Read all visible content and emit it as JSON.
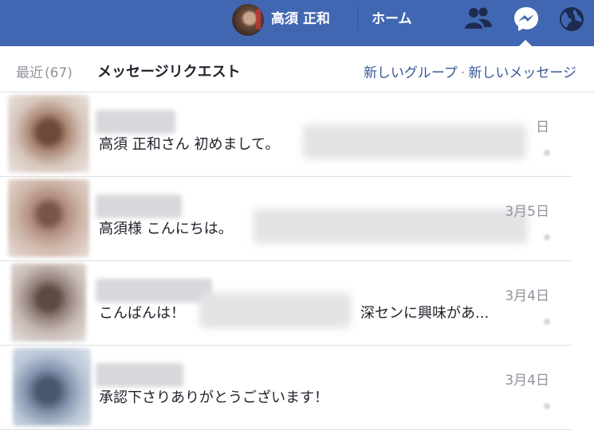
{
  "topbar": {
    "user_name": "高須 正和",
    "home_label": "ホーム",
    "icons": [
      "friends-icon",
      "messenger-icon",
      "globe-icon"
    ],
    "background": "#4267b2"
  },
  "header": {
    "recent_label": "最近",
    "recent_count": "(67)",
    "requests_label": "メッセージリクエスト",
    "new_group_label": "新しいグループ",
    "separator": "·",
    "new_message_label": "新しいメッセージ"
  },
  "messages": [
    {
      "text": "高須 正和さん 初めまして。",
      "date": "日"
    },
    {
      "text": "高須様 こんにちは。",
      "date": "3月5日"
    },
    {
      "text": "こんばんは！",
      "text_tail": "深センに興味があ...",
      "date": "3月4日"
    },
    {
      "text": "承認下さりありがとうございます！",
      "date": "3月4日"
    }
  ]
}
